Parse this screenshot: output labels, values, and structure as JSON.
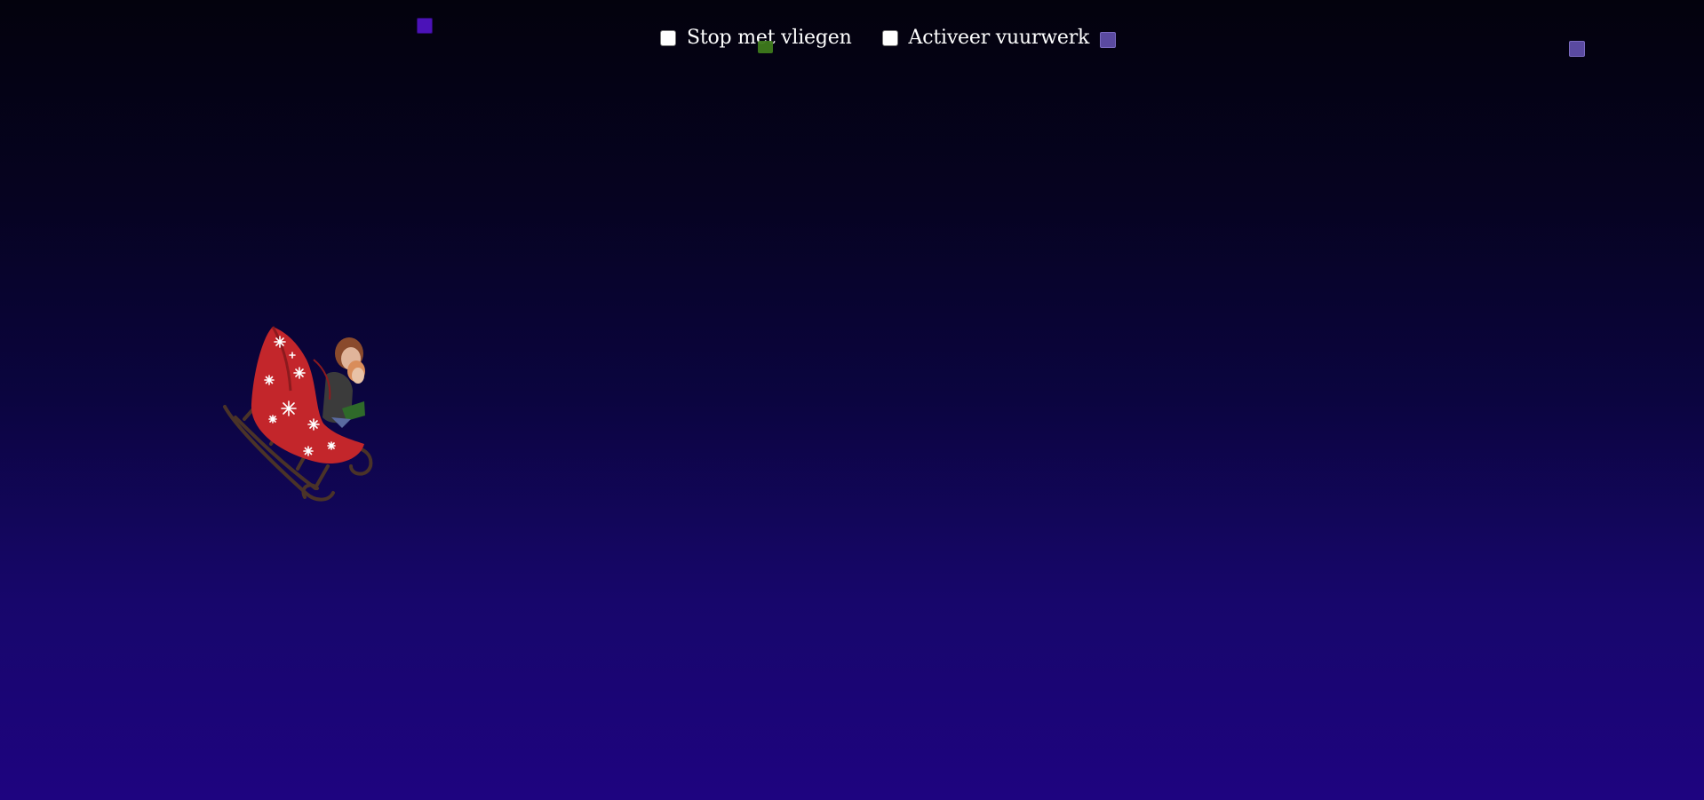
{
  "controls": {
    "stop_flying_label": "Stop met vliegen",
    "fireworks_label": "Activeer vuurwerk"
  },
  "colors": {
    "sky_top": "#03020d",
    "sky_bottom": "#1e0480",
    "sleigh_red": "#c3262b",
    "runner_brown": "#4a3328"
  },
  "icons": {
    "sleigh": "sleigh-with-riders-image"
  }
}
